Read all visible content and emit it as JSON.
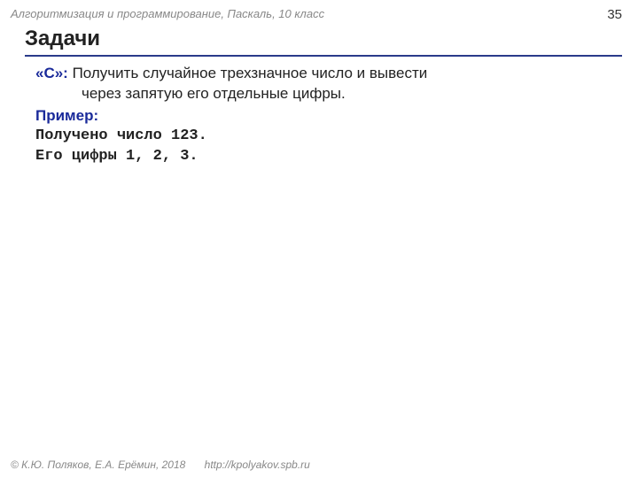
{
  "header": {
    "breadcrumb": "Алгоритмизация и программирование, Паскаль, 10 класс",
    "page_number": "35"
  },
  "title": "Задачи",
  "task": {
    "label": "«C»:",
    "text_line1": " Получить случайное трехзначное число и вывести",
    "text_line2": "через запятую его отдельные цифры."
  },
  "example": {
    "label": "Пример:",
    "line1": "Получено число 123.",
    "line2": "Его цифры 1, 2, 3."
  },
  "footer": {
    "copyright": "© К.Ю. Поляков, Е.А. Ерёмин, 2018",
    "url": "http://kpolyakov.spb.ru"
  }
}
